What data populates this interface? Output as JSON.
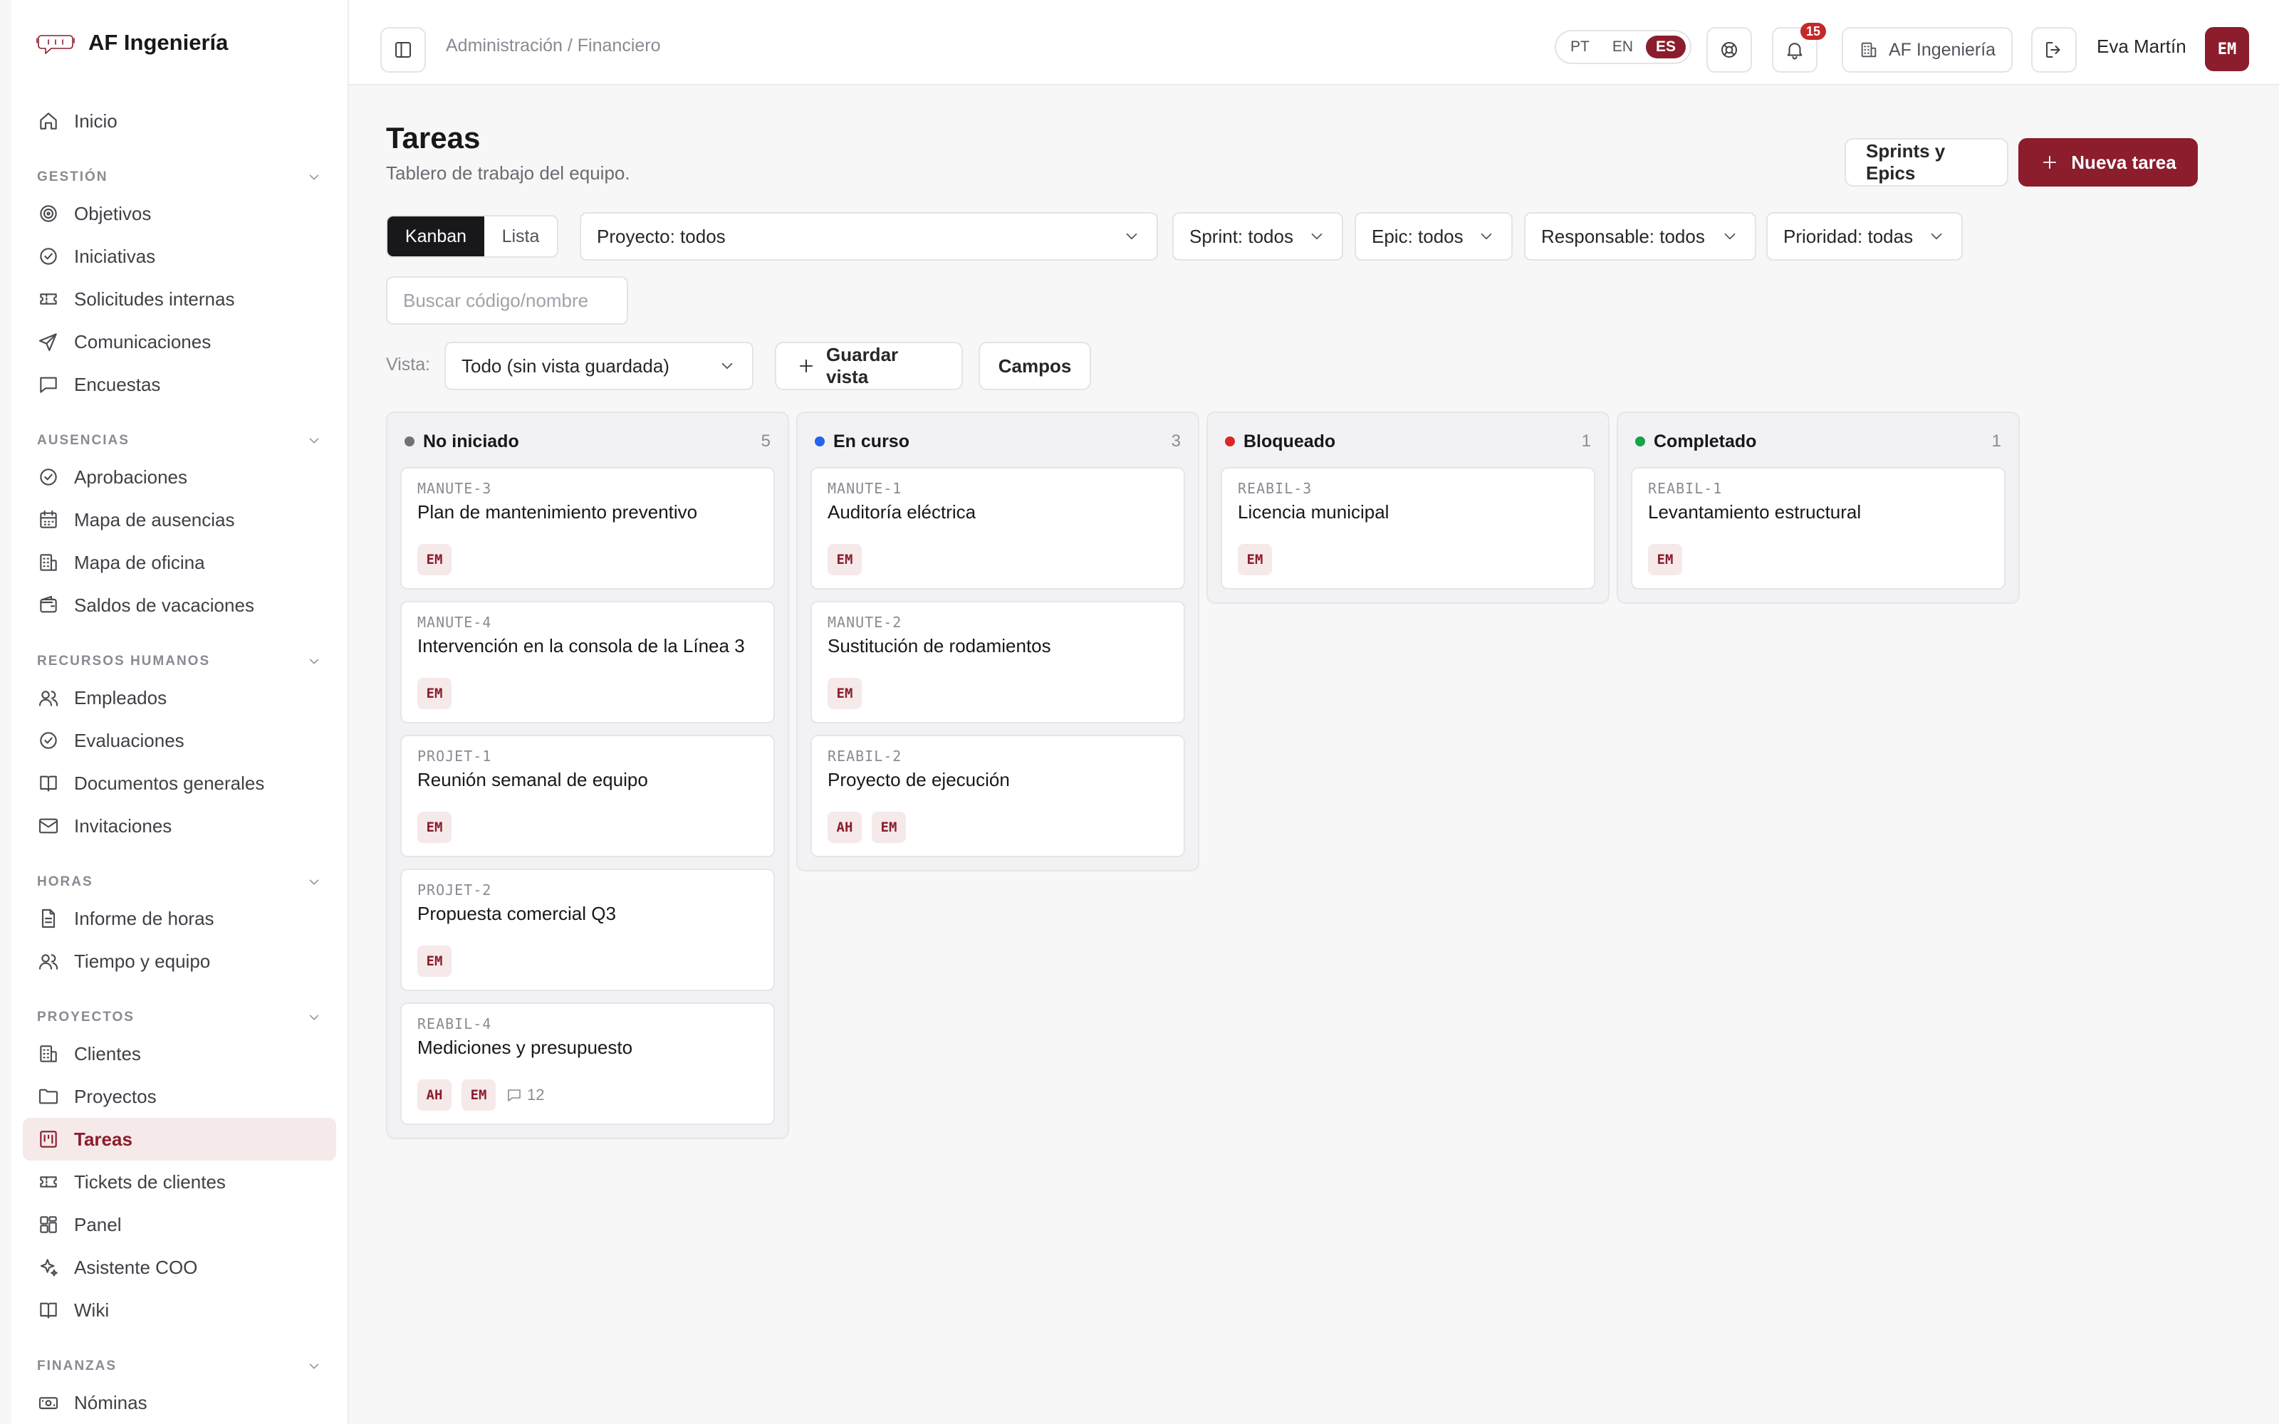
{
  "brand": {
    "name": "AF Ingeniería"
  },
  "sidebar": {
    "top": [
      {
        "label": "Inicio",
        "icon": "home-icon"
      }
    ],
    "sections": [
      {
        "title": "GESTIÓN",
        "items": [
          {
            "label": "Objetivos",
            "icon": "target-icon"
          },
          {
            "label": "Iniciativas",
            "icon": "check-circle-icon"
          },
          {
            "label": "Solicitudes internas",
            "icon": "ticket-icon"
          },
          {
            "label": "Comunicaciones",
            "icon": "send-icon"
          },
          {
            "label": "Encuestas",
            "icon": "message-square-icon"
          }
        ]
      },
      {
        "title": "AUSENCIAS",
        "items": [
          {
            "label": "Aprobaciones",
            "icon": "check-circle-icon"
          },
          {
            "label": "Mapa de ausencias",
            "icon": "calendar-icon"
          },
          {
            "label": "Mapa de oficina",
            "icon": "building-icon"
          },
          {
            "label": "Saldos de vacaciones",
            "icon": "wallet-icon"
          }
        ]
      },
      {
        "title": "RECURSOS HUMANOS",
        "items": [
          {
            "label": "Empleados",
            "icon": "users-icon"
          },
          {
            "label": "Evaluaciones",
            "icon": "check-circle-icon"
          },
          {
            "label": "Documentos generales",
            "icon": "book-icon"
          },
          {
            "label": "Invitaciones",
            "icon": "mail-icon"
          }
        ]
      },
      {
        "title": "HORAS",
        "items": [
          {
            "label": "Informe de horas",
            "icon": "file-text-icon"
          },
          {
            "label": "Tiempo y equipo",
            "icon": "users-icon"
          }
        ]
      },
      {
        "title": "PROYECTOS",
        "items": [
          {
            "label": "Clientes",
            "icon": "building-icon"
          },
          {
            "label": "Proyectos",
            "icon": "folder-icon"
          },
          {
            "label": "Tareas",
            "icon": "kanban-icon",
            "active": true
          },
          {
            "label": "Tickets de clientes",
            "icon": "ticket-icon"
          },
          {
            "label": "Panel",
            "icon": "layout-grid-icon"
          },
          {
            "label": "Asistente COO",
            "icon": "sparkles-icon"
          },
          {
            "label": "Wiki",
            "icon": "book-icon"
          }
        ]
      },
      {
        "title": "FINANZAS",
        "items": [
          {
            "label": "Nóminas",
            "icon": "banknote-icon"
          }
        ]
      }
    ]
  },
  "header": {
    "breadcrumb": "Administración / Financiero",
    "languages": [
      "PT",
      "EN",
      "ES"
    ],
    "active_language": "ES",
    "notifications_count": "15",
    "company": "AF Ingeniería",
    "user_name": "Eva Martín",
    "user_initials": "EM"
  },
  "page": {
    "title": "Tareas",
    "subtitle": "Tablero de trabajo del equipo.",
    "sprints_button": "Sprints y Epics",
    "new_task_button": "Nueva tarea"
  },
  "filters": {
    "view_toggle": [
      "Kanban",
      "Lista"
    ],
    "active_view": "Kanban",
    "project": "Proyecto: todos",
    "sprint": "Sprint: todos",
    "epic": "Epic: todos",
    "assignee": "Responsable: todos",
    "priority": "Prioridad: todas",
    "search_placeholder": "Buscar código/nombre",
    "vista_label": "Vista:",
    "vista_value": "Todo (sin vista guardada)",
    "save_view": "Guardar vista",
    "fields": "Campos"
  },
  "colors": {
    "accent": "#8b1d2c",
    "not_started": "#71717a",
    "in_progress": "#2563eb",
    "blocked": "#dc2626",
    "done": "#16a34a"
  },
  "kanban": {
    "columns": [
      {
        "title": "No iniciado",
        "count": "5",
        "color": "#71717a",
        "cards": [
          {
            "code": "MANUTE-3",
            "title": "Plan de mantenimiento preventivo",
            "assignees": [
              "EM"
            ]
          },
          {
            "code": "MANUTE-4",
            "title": "Intervención en la consola de la Línea 3",
            "assignees": [
              "EM"
            ]
          },
          {
            "code": "PROJET-1",
            "title": "Reunión semanal de equipo",
            "assignees": [
              "EM"
            ]
          },
          {
            "code": "PROJET-2",
            "title": "Propuesta comercial Q3",
            "assignees": [
              "EM"
            ]
          },
          {
            "code": "REABIL-4",
            "title": "Mediciones y presupuesto",
            "assignees": [
              "AH",
              "EM"
            ],
            "comments": "12"
          }
        ]
      },
      {
        "title": "En curso",
        "count": "3",
        "color": "#2563eb",
        "cards": [
          {
            "code": "MANUTE-1",
            "title": "Auditoría eléctrica",
            "assignees": [
              "EM"
            ]
          },
          {
            "code": "MANUTE-2",
            "title": "Sustitución de rodamientos",
            "assignees": [
              "EM"
            ]
          },
          {
            "code": "REABIL-2",
            "title": "Proyecto de ejecución",
            "assignees": [
              "AH",
              "EM"
            ]
          }
        ]
      },
      {
        "title": "Bloqueado",
        "count": "1",
        "color": "#dc2626",
        "cards": [
          {
            "code": "REABIL-3",
            "title": "Licencia municipal",
            "assignees": [
              "EM"
            ]
          }
        ]
      },
      {
        "title": "Completado",
        "count": "1",
        "color": "#16a34a",
        "cards": [
          {
            "code": "REABIL-1",
            "title": "Levantamiento estructural",
            "assignees": [
              "EM"
            ]
          }
        ]
      }
    ]
  }
}
